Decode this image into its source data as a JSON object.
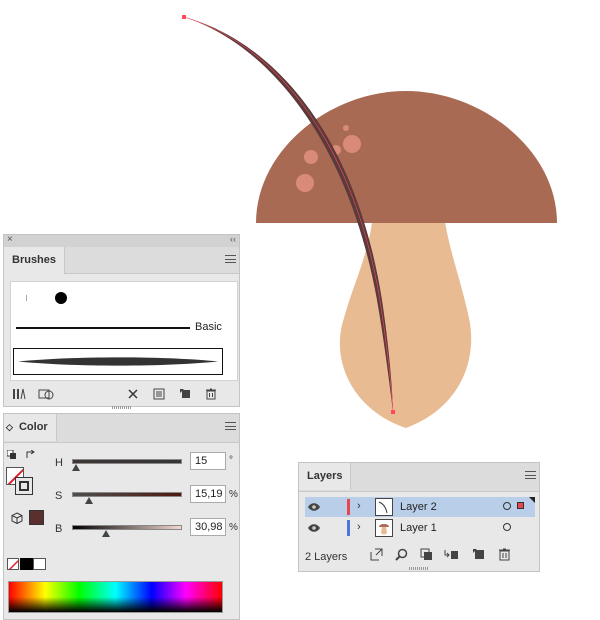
{
  "brushes_panel": {
    "close_glyph": "×",
    "collapse_glyph": "‹‹",
    "tab_label": "Brushes",
    "basic_brush_label": "Basic",
    "bottom_tools": [
      "brush-libraries-icon",
      "libraries-panel-icon",
      "remove-stroke-icon",
      "brush-options-icon",
      "new-brush-icon",
      "delete-brush-icon"
    ]
  },
  "color_panel": {
    "tab_label": "Color",
    "tab_arrow": "◇",
    "fill_color": "#5c2f2f",
    "sliders": [
      {
        "label": "H",
        "value": "15",
        "unit": "°",
        "fraction": 0.04
      },
      {
        "label": "S",
        "value": "15,19",
        "unit": "%",
        "fraction": 0.15
      },
      {
        "label": "B",
        "value": "30,98",
        "unit": "%",
        "fraction": 0.31
      }
    ]
  },
  "layers_panel": {
    "tab_label": "Layers",
    "layers": [
      {
        "name": "Layer 2",
        "color": "#e8464f",
        "selected": true
      },
      {
        "name": "Layer 1",
        "color": "#4a78e0",
        "selected": false
      }
    ],
    "count_label": "2 Layers",
    "footer_tools": [
      "export-icon",
      "locate-object-icon",
      "clipping-mask-icon",
      "new-sublayer-icon",
      "new-layer-icon",
      "delete-layer-icon"
    ]
  },
  "artwork": {
    "cap_color": "#a96a54",
    "stem_color": "#e8bb92",
    "spot_color": "#d98a78",
    "stroke_color": "#5a3a3a",
    "anchor_color": "#ff4a5e"
  }
}
